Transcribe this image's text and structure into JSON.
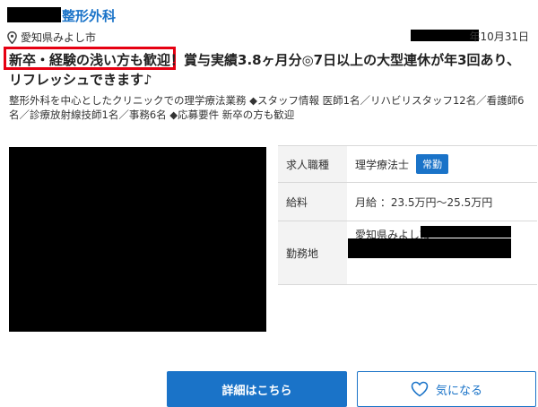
{
  "header": {
    "clinic_title": "整形外科",
    "location": "愛知県みよし市",
    "date": "年10月31日"
  },
  "listing": {
    "headline": "新卒・経験の浅い方も歓迎！賞与実績3.8ヶ月分◎7日以上の大型連休が年3回あり、リフレッシュできます♪",
    "description": "整形外科を中心としたクリニックでの理学療法業務 ◆スタッフ情報 医師1名／リハビリスタッフ12名／看護師6名／診療放射線技師1名／事務6名 ◆応募要件 新卒の方も歓迎"
  },
  "details": {
    "job_type_label": "求人職種",
    "job_type_value": "理学療法士",
    "employment_badge": "常勤",
    "salary_label": "給料",
    "salary_value": "月給 ：23.5万円〜25.5万円",
    "workplace_label": "勤務地",
    "workplace_value": "愛知県みよし市"
  },
  "actions": {
    "detail_button": "詳細はこちら",
    "favorite_button": "気になる"
  },
  "colors": {
    "accent": "#1a73c8",
    "highlight_border": "#e60012"
  },
  "icons": {
    "location": "map-pin-icon",
    "favorite": "heart-outline-icon"
  }
}
